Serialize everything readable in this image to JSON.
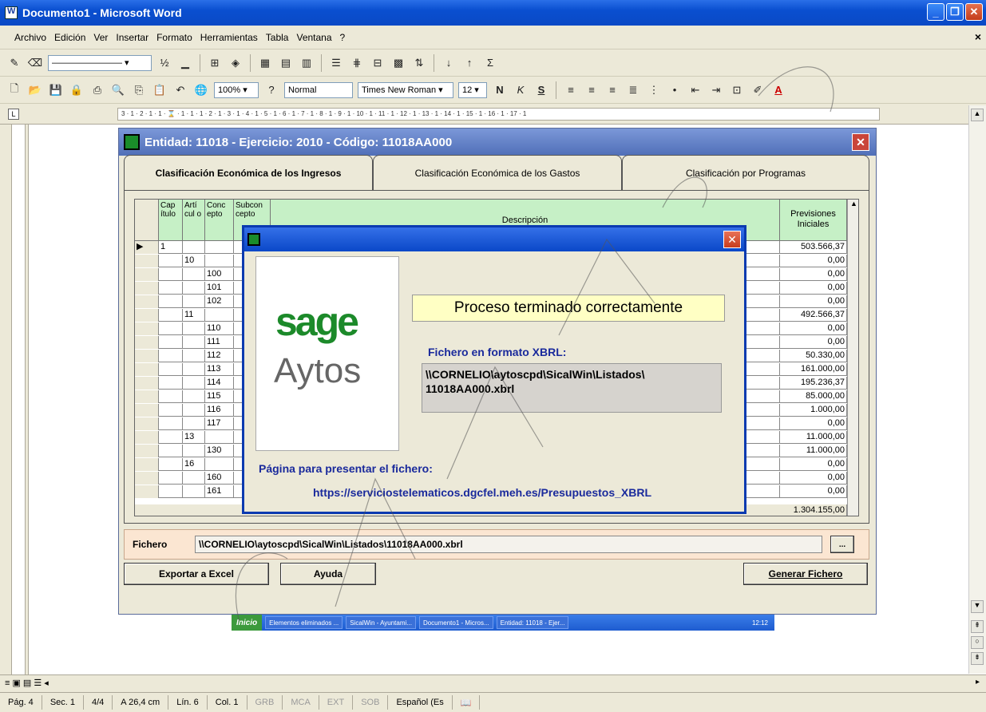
{
  "word": {
    "title": "Documento1 - Microsoft Word",
    "menu": [
      "Archivo",
      "Edición",
      "Ver",
      "Insertar",
      "Formato",
      "Herramientas",
      "Tabla",
      "Ventana",
      "?"
    ],
    "menu_close": "×",
    "zoom": "100%",
    "style": "Normal",
    "font": "Times New Roman",
    "size": "12",
    "ruler_text": "3 · 1 · 2 · 1 · 1 · ⌛ · 1 · 1 · 1 · 2 · 1 · 3 · 1 · 4 · 1 · 5 · 1 · 6 · 1 · 7 · 1 · 8 · 1 · 9 · 1 · 10 · 1 · 11 · 1 · 12 · 1 · 13 · 1 · 14 · 1 · 15 · 1 · 16 · 1 · 17 · 1",
    "status": {
      "page": "Pág. 4",
      "sec": "Sec. 1",
      "pages": "4/4",
      "at": "A 26,4 cm",
      "line": "Lín. 6",
      "col": "Col. 1",
      "grb": "GRB",
      "mca": "MCA",
      "ext": "EXT",
      "sob": "SOB",
      "lang": "Español (Es"
    }
  },
  "app": {
    "title": "Entidad: 11018 - Ejercicio: 2010 - Código: 11018AA000",
    "tabs": [
      "Clasificación Económica de los Ingresos",
      "Clasificación Económica de los Gastos",
      "Clasificación por Programas"
    ],
    "headers": {
      "cap": "Cap ítulo",
      "art": "Artí cul o",
      "conc": "Conc epto",
      "subc": "Subcon cepto",
      "desc": "Descripción",
      "prev": "Previsiones Iniciales"
    },
    "rows": [
      {
        "cap": "1",
        "art": "",
        "conc": "",
        "prev": "503.566,37"
      },
      {
        "cap": "",
        "art": "10",
        "conc": "",
        "prev": "0,00"
      },
      {
        "cap": "",
        "art": "",
        "conc": "100",
        "prev": "0,00"
      },
      {
        "cap": "",
        "art": "",
        "conc": "101",
        "prev": "0,00"
      },
      {
        "cap": "",
        "art": "",
        "conc": "102",
        "prev": "0,00"
      },
      {
        "cap": "",
        "art": "11",
        "conc": "",
        "prev": "492.566,37"
      },
      {
        "cap": "",
        "art": "",
        "conc": "110",
        "prev": "0,00"
      },
      {
        "cap": "",
        "art": "",
        "conc": "111",
        "prev": "0,00"
      },
      {
        "cap": "",
        "art": "",
        "conc": "112",
        "prev": "50.330,00"
      },
      {
        "cap": "",
        "art": "",
        "conc": "113",
        "prev": "161.000,00"
      },
      {
        "cap": "",
        "art": "",
        "conc": "114",
        "prev": "195.236,37"
      },
      {
        "cap": "",
        "art": "",
        "conc": "115",
        "prev": "85.000,00"
      },
      {
        "cap": "",
        "art": "",
        "conc": "116",
        "prev": "1.000,00"
      },
      {
        "cap": "",
        "art": "",
        "conc": "117",
        "prev": "0,00"
      },
      {
        "cap": "",
        "art": "13",
        "conc": "",
        "prev": "11.000,00"
      },
      {
        "cap": "",
        "art": "",
        "conc": "130",
        "prev": "11.000,00"
      },
      {
        "cap": "",
        "art": "16",
        "conc": "",
        "prev": "0,00"
      },
      {
        "cap": "",
        "art": "",
        "conc": "160",
        "prev": "0,00"
      },
      {
        "cap": "",
        "art": "",
        "conc": "161",
        "prev": "0,00"
      }
    ],
    "total": "1.304.155,00",
    "fichero_label": "Fichero",
    "fichero_path": "\\\\CORNELIO\\aytoscpd\\SicalWin\\Listados\\11018AA000.xbrl",
    "browse": "...",
    "btn_export": "Exportar a Excel",
    "btn_help": "Ayuda",
    "btn_generate": "Generar Fichero"
  },
  "dialog": {
    "logo_top": "sage",
    "logo_bottom": "Aytos",
    "status": "Proceso terminado correctamente",
    "file_label": "Fichero en formato XBRL:",
    "file_path": "\\\\CORNELIO\\aytoscpd\\SicalWin\\Listados\\ 11018AA000.xbrl",
    "page_label": "Página para presentar el fichero:",
    "url": "https://serviciostelematicos.dgcfel.meh.es/Presupuestos_XBRL"
  },
  "taskbar": {
    "start": "Inicio",
    "tasks": [
      "Elementos eliminados ...",
      "SicalWin - Ayuntami...",
      "Documento1 - Micros...",
      "Entidad: 11018 - Ejer..."
    ],
    "clock": "12:12"
  },
  "colors": {
    "xp_blue": "#0a49c5",
    "grid_header": "#c6f0c6",
    "sage_green": "#1c8a2a",
    "dialog_link": "#1a2a9c"
  }
}
